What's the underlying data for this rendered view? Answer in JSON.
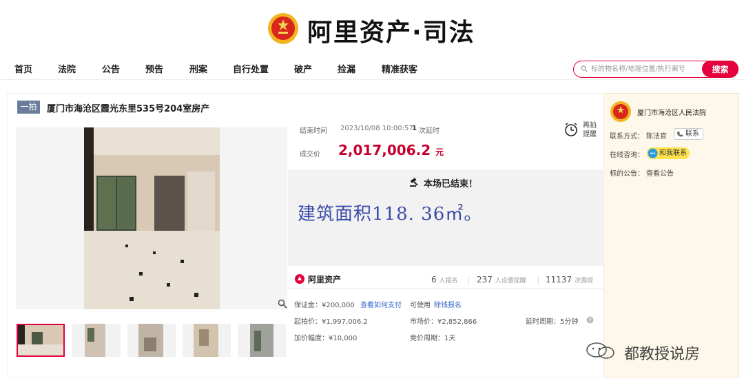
{
  "header": {
    "brand": "阿里资产·司法"
  },
  "nav": [
    "首页",
    "法院",
    "公告",
    "预告",
    "刑案",
    "自行处置",
    "破产",
    "捡漏",
    "精准获客"
  ],
  "search": {
    "placeholder": "标的物名称/地理位置/执行案号",
    "button": "搜索"
  },
  "listing": {
    "badge": "一拍",
    "title": "厦门市海沧区霞光东里535号204室房产",
    "end_time_label": "结束时间",
    "end_time_value": "2023/10/08 10:00:57",
    "delay_count": "1",
    "delay_text": "次延时",
    "deal_label": "成交价",
    "deal_price": "2,017,006.2",
    "deal_unit": "元",
    "remind_label_1": "再拍",
    "remind_label_2": "提醒",
    "ended": "本场已结束！",
    "area_note": "建筑面积118. 36㎡。",
    "platform": "阿里资产",
    "signups": "6",
    "signups_label": "人报名",
    "reminders": "237",
    "reminders_label": "人设置提醒",
    "views": "11137",
    "views_label": "次围观",
    "deposit": "保证金：¥200,000",
    "how_to_pay": "查看如何支付",
    "can_use": "可使用",
    "loan_signup": "除钱报名",
    "start_price": "起拍价：¥1,997,006.2",
    "market_price": "市场价：¥2,852,866",
    "delay_period": "延时周期：5分钟",
    "increment": "加价幅度：¥10,000",
    "bid_period": "竞价周期：1天"
  },
  "court": {
    "name": "厦门市海沧区人民法院",
    "contact_label": "联系方式：",
    "contact_name": "陈法官",
    "contact_button": "联系",
    "consult_label": "在线咨询：",
    "consult_button": "和我联系",
    "notice_label": "标的公告：",
    "notice_link": "查看公告"
  },
  "watermark": "都教授说房",
  "colors": {
    "accent": "#e4003c",
    "price": "#c6002f",
    "badge": "#6b7d9d",
    "area_text": "#3b4ba8"
  }
}
